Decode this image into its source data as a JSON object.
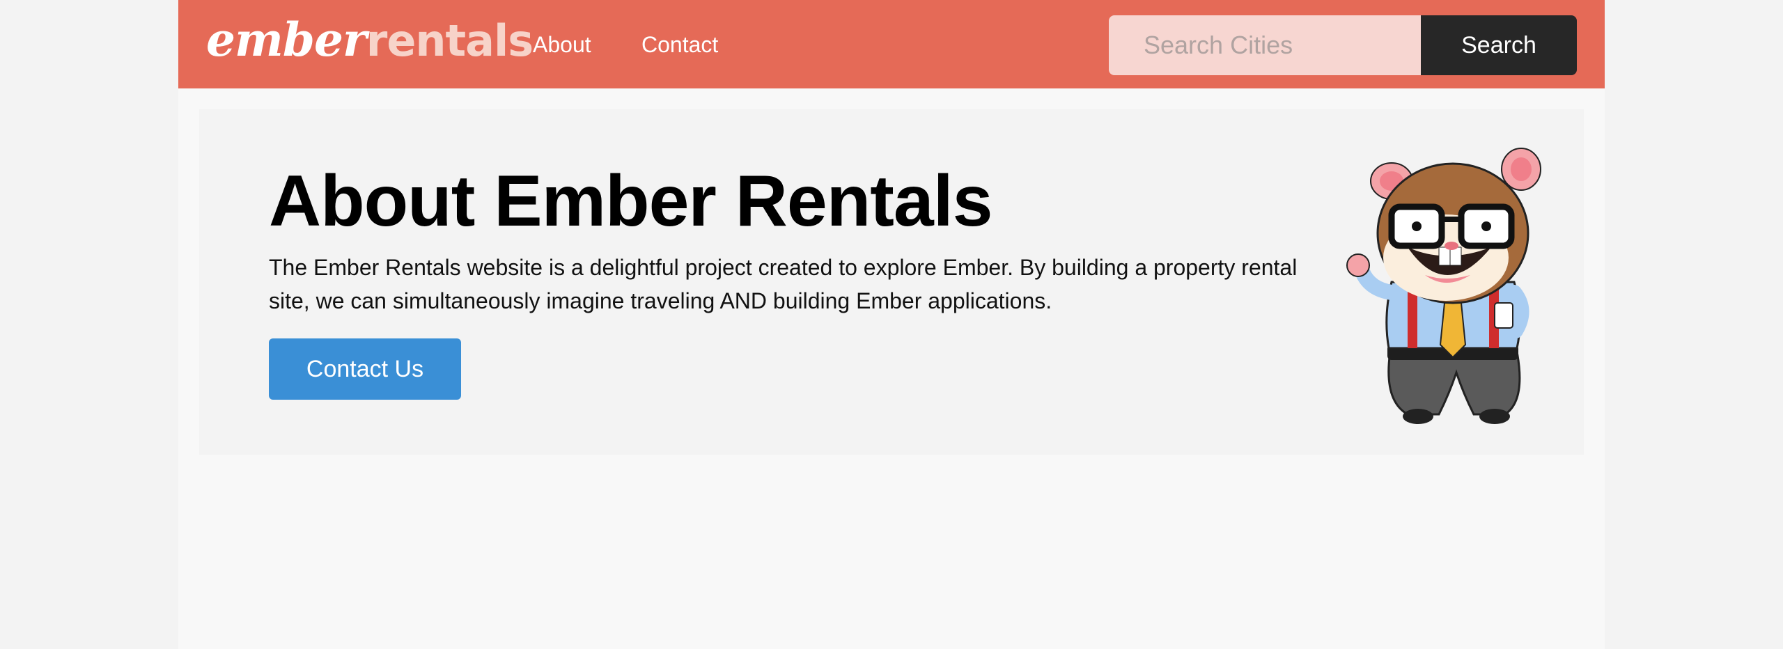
{
  "header": {
    "logo_ember": "ember",
    "logo_rentals": "rentals",
    "nav": [
      {
        "label": "About"
      },
      {
        "label": "Contact"
      }
    ],
    "search": {
      "placeholder": "Search Cities",
      "button_label": "Search"
    }
  },
  "main": {
    "title": "About Ember Rentals",
    "body": "The Ember Rentals website is a delightful project created to explore Ember. By building a property rental site, we can simultaneously imagine traveling AND building Ember applications.",
    "contact_button": "Contact Us",
    "mascot_icon": "tomster-mascot-icon"
  },
  "colors": {
    "nav_bg": "#e56a57",
    "search_bg": "#f7d6d1",
    "search_button_bg": "#272727",
    "contact_button_bg": "#3a8fd6",
    "jumbo_bg": "#f3f3f3"
  }
}
